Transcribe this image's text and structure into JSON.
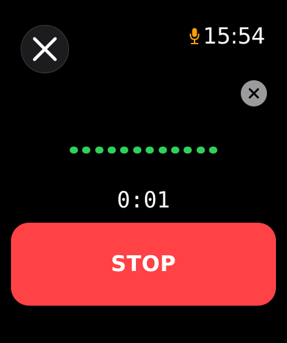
{
  "header": {
    "close_icon": "close-icon",
    "mic_icon": "microphone-icon",
    "time": "15:54"
  },
  "recording": {
    "dismiss_icon": "small-close-icon",
    "waveform_dot_count": 12,
    "elapsed": "0:01"
  },
  "actions": {
    "stop_label": "STOP"
  },
  "colors": {
    "background": "#000000",
    "mic_accent": "#ff9f0a",
    "waveform": "#30d158",
    "stop_button": "#ff4245",
    "dismiss_button": "#9b9b9e"
  }
}
